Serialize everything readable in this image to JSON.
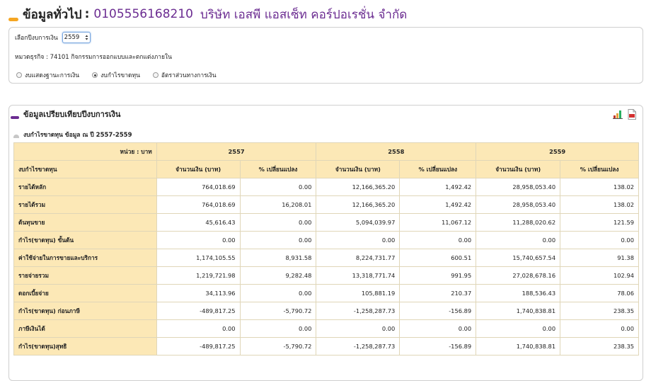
{
  "header": {
    "label": "ข้อมูลทั่วไป",
    "separator": ":",
    "company_id": "0105556168210",
    "company_name": "บริษัท เอสพี แอสเซ็ท คอร์ปอเรชั่น จำกัด"
  },
  "filter": {
    "fiscal_year_label": "เลือกปีงบการเงิน",
    "fiscal_year_value": "2559",
    "business_type": "หมวดธุรกิจ : 74101 กิจกรรมการออกแบบและตกแต่งภายใน",
    "radios": [
      {
        "label": "งบแสดงฐานะการเงิน",
        "checked": false
      },
      {
        "label": "งบกำไรขาดทุน",
        "checked": true
      },
      {
        "label": "อัตราส่วนทางการเงิน",
        "checked": false
      }
    ]
  },
  "compare": {
    "title": "ข้อมูลเปรียบเทียบปีงบการเงิน",
    "subtitle": "งบกำไรขาดทุน ข้อมูล ณ ปี 2557-2559",
    "unit_label": "หน่วย : บาท",
    "years": [
      "2557",
      "2558",
      "2559"
    ],
    "row_header": "งบกำไรขาดทุน",
    "col_amount": "จำนวนเงิน (บาท)",
    "col_change": "% เปลี่ยนแปลง",
    "rows": [
      {
        "label": "รายได้หลัก",
        "values": [
          "764,018.69",
          "0.00",
          "12,166,365.20",
          "1,492.42",
          "28,958,053.40",
          "138.02"
        ]
      },
      {
        "label": "รายได้รวม",
        "values": [
          "764,018.69",
          "16,208.01",
          "12,166,365.20",
          "1,492.42",
          "28,958,053.40",
          "138.02"
        ]
      },
      {
        "label": "ต้นทุนขาย",
        "values": [
          "45,616.43",
          "0.00",
          "5,094,039.97",
          "11,067.12",
          "11,288,020.62",
          "121.59"
        ]
      },
      {
        "label": "กำไร(ขาดทุน) ขั้นต้น",
        "values": [
          "0.00",
          "0.00",
          "0.00",
          "0.00",
          "0.00",
          "0.00"
        ]
      },
      {
        "label": "ค่าใช้จ่ายในการขายและบริการ",
        "values": [
          "1,174,105.55",
          "8,931.58",
          "8,224,731.77",
          "600.51",
          "15,740,657.54",
          "91.38"
        ]
      },
      {
        "label": "รายจ่ายรวม",
        "values": [
          "1,219,721.98",
          "9,282.48",
          "13,318,771.74",
          "991.95",
          "27,028,678.16",
          "102.94"
        ]
      },
      {
        "label": "ดอกเบี้ยจ่าย",
        "values": [
          "34,113.96",
          "0.00",
          "105,881.19",
          "210.37",
          "188,536.43",
          "78.06"
        ]
      },
      {
        "label": "กำไร(ขาดทุน) ก่อนภาษี",
        "values": [
          "-489,817.25",
          "-5,790.72",
          "-1,258,287.73",
          "-156.89",
          "1,740,838.81",
          "238.35"
        ]
      },
      {
        "label": "ภาษีเงินได้",
        "values": [
          "0.00",
          "0.00",
          "0.00",
          "0.00",
          "0.00",
          "0.00"
        ]
      },
      {
        "label": "กำไร(ขาดทุน)สุทธิ",
        "values": [
          "-489,817.25",
          "-5,790.72",
          "-1,258,287.73",
          "-156.89",
          "1,740,838.81",
          "238.35"
        ]
      }
    ]
  },
  "icons": {
    "excel": "excel-export-icon",
    "pdf": "pdf-export-icon"
  },
  "colors": {
    "accent_orange": "#f5a623",
    "accent_purple": "#6b2c91",
    "table_header": "#fce8b6"
  }
}
